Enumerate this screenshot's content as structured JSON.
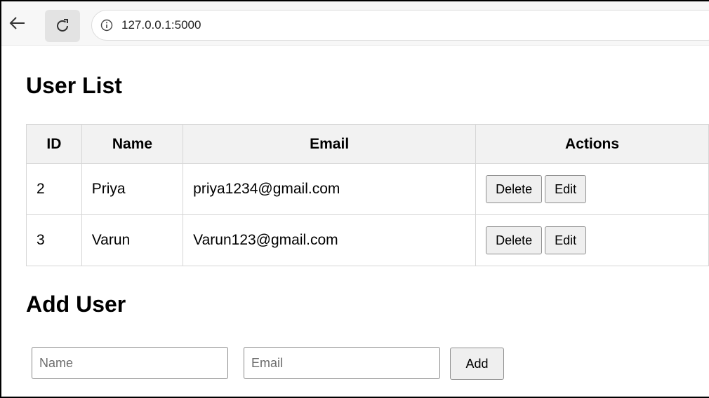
{
  "browser": {
    "url": "127.0.0.1:5000",
    "icons": {
      "back": "arrow-left-icon",
      "reload": "reload-icon",
      "info": "info-icon"
    }
  },
  "user_list": {
    "title": "User List",
    "columns": [
      "ID",
      "Name",
      "Email",
      "Actions"
    ],
    "rows": [
      {
        "id": "2",
        "name": "Priya",
        "email": "priya1234@gmail.com",
        "delete_label": "Delete",
        "edit_label": "Edit"
      },
      {
        "id": "3",
        "name": "Varun",
        "email": "Varun123@gmail.com",
        "delete_label": "Delete",
        "edit_label": "Edit"
      }
    ]
  },
  "add_user": {
    "title": "Add User",
    "name_placeholder": "Name",
    "name_value": "",
    "email_placeholder": "Email",
    "email_value": "",
    "add_label": "Add"
  },
  "colors": {
    "header_bg": "#f2f2f2",
    "button_bg": "#efefef",
    "border": "#d6d6d6"
  }
}
